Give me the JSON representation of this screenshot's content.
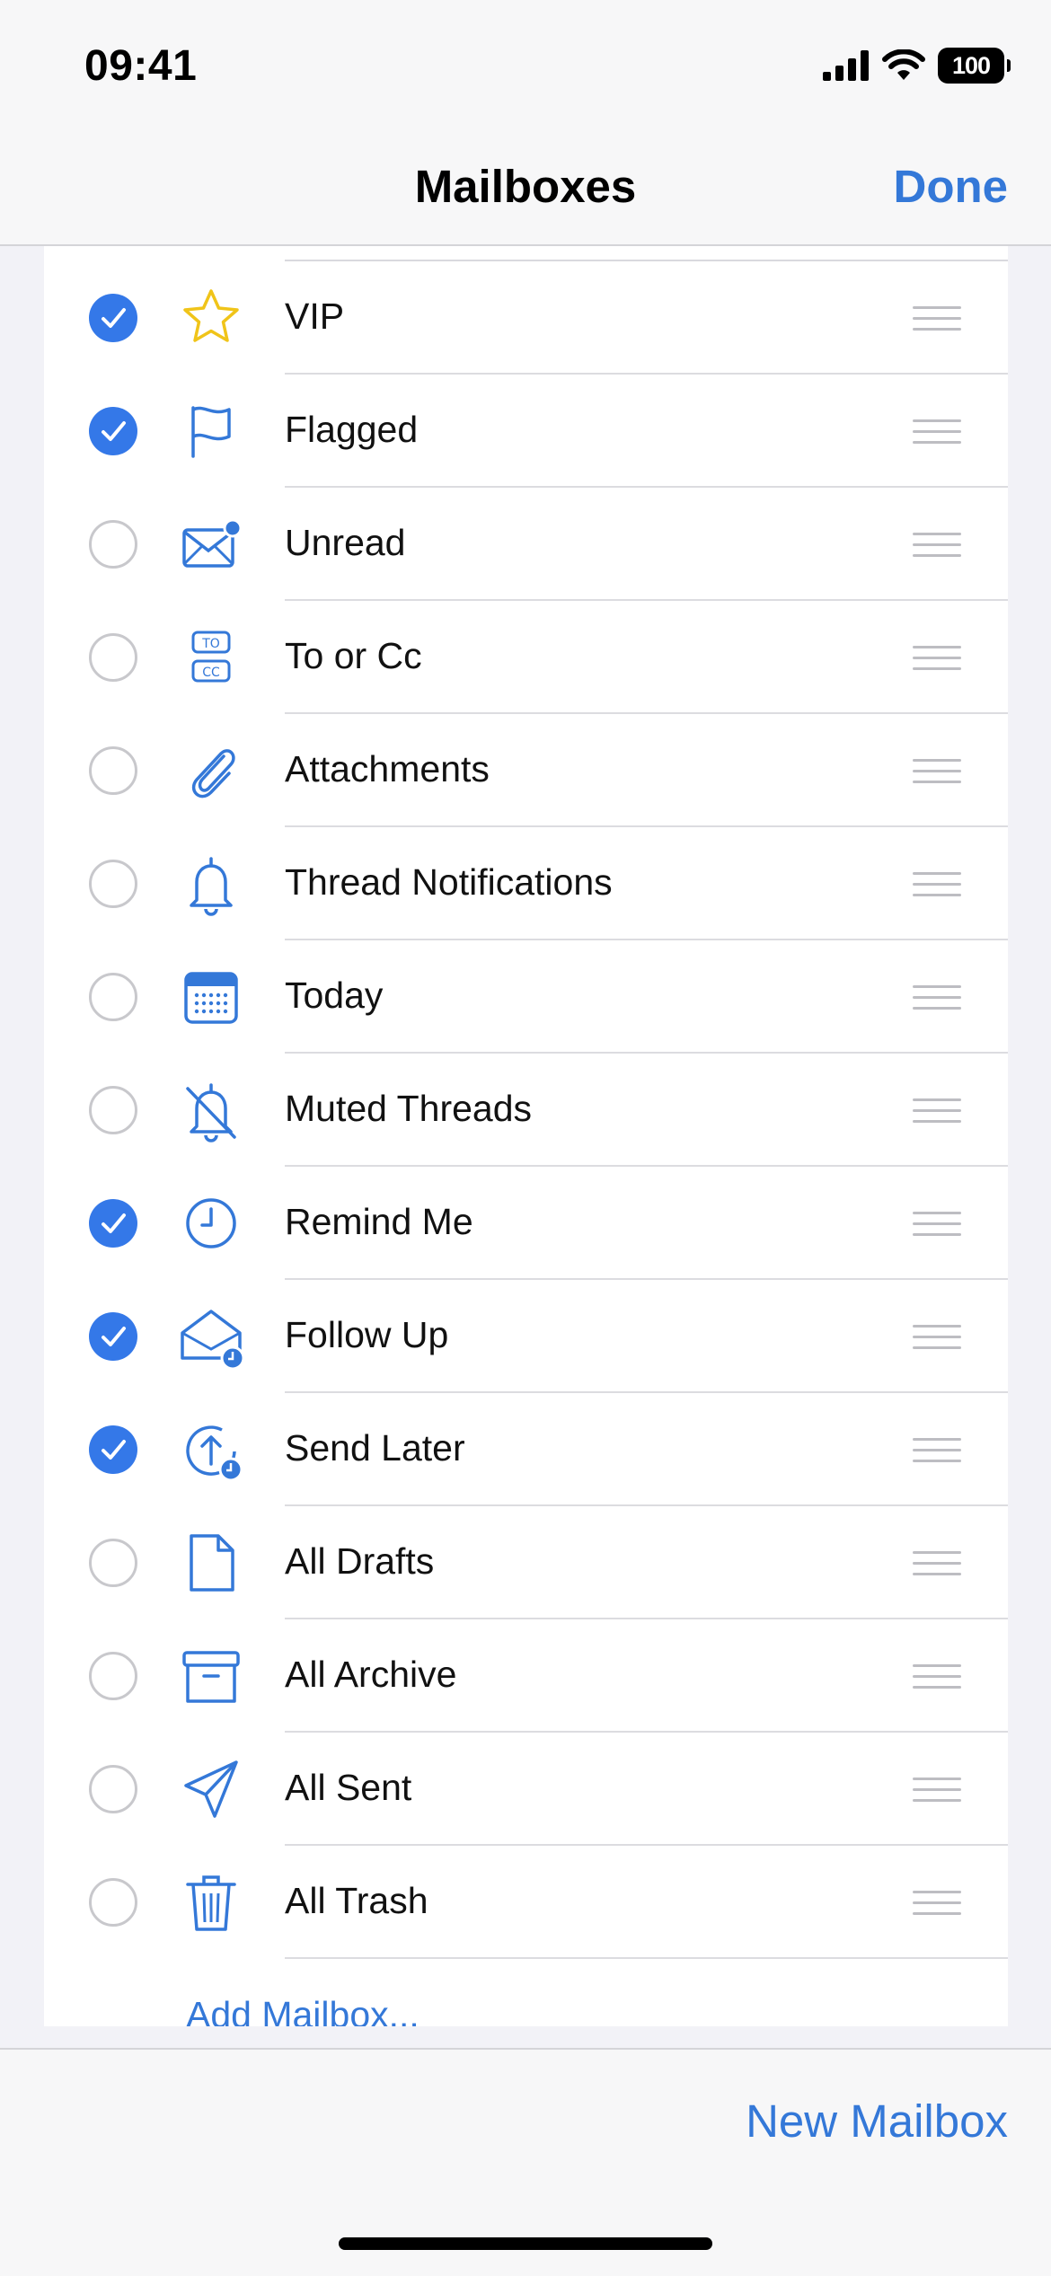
{
  "status_bar": {
    "time": "09:41",
    "battery": "100"
  },
  "nav": {
    "title": "Mailboxes",
    "done_label": "Done"
  },
  "mailboxes": [
    {
      "label": "VIP",
      "checked": true,
      "icon": "star-icon"
    },
    {
      "label": "Flagged",
      "checked": true,
      "icon": "flag-icon"
    },
    {
      "label": "Unread",
      "checked": false,
      "icon": "unread-envelope-icon"
    },
    {
      "label": "To or Cc",
      "checked": false,
      "icon": "to-cc-icon"
    },
    {
      "label": "Attachments",
      "checked": false,
      "icon": "paperclip-icon"
    },
    {
      "label": "Thread Notifications",
      "checked": false,
      "icon": "bell-icon"
    },
    {
      "label": "Today",
      "checked": false,
      "icon": "calendar-icon"
    },
    {
      "label": "Muted Threads",
      "checked": false,
      "icon": "bell-slash-icon"
    },
    {
      "label": "Remind Me",
      "checked": true,
      "icon": "clock-icon"
    },
    {
      "label": "Follow Up",
      "checked": true,
      "icon": "envelope-clock-icon"
    },
    {
      "label": "Send Later",
      "checked": true,
      "icon": "send-later-icon"
    },
    {
      "label": "All Drafts",
      "checked": false,
      "icon": "document-icon"
    },
    {
      "label": "All Archive",
      "checked": false,
      "icon": "archive-box-icon"
    },
    {
      "label": "All Sent",
      "checked": false,
      "icon": "paperplane-icon"
    },
    {
      "label": "All Trash",
      "checked": false,
      "icon": "trash-icon"
    }
  ],
  "add_mailbox_label": "Add Mailbox...",
  "toolbar": {
    "new_mailbox_label": "New Mailbox"
  },
  "colors": {
    "accent": "#3478d8",
    "star": "#f0c419",
    "background": "#f2f2f7"
  }
}
